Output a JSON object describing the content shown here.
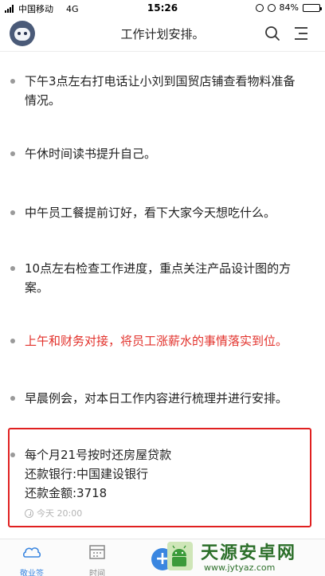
{
  "status_bar": {
    "carrier": "中国移动",
    "network": "4G",
    "time": "15:26",
    "battery": "84%",
    "battery_level": 0.84
  },
  "header": {
    "title": "工作计划安排。",
    "search_icon": "search-icon",
    "menu_icon": "menu-icon",
    "avatar_icon": "robot-avatar-icon"
  },
  "items": [
    {
      "text": "下午3点左右打电话让小刘到国贸店铺查看物料准备情况。",
      "color": "#222222"
    },
    {
      "text": "午休时间读书提升自己。",
      "color": "#222222"
    },
    {
      "text": "中午员工餐提前订好，看下大家今天想吃什么。",
      "color": "#222222"
    },
    {
      "text": "10点左右检查工作进度，重点关注产品设计图的方案。",
      "color": "#222222"
    },
    {
      "text": "上午和财务对接，将员工涨薪水的事情落实到位。",
      "color": "#e2312b"
    },
    {
      "text": "早晨例会，对本日工作内容进行梳理并进行安排。",
      "color": "#222222"
    }
  ],
  "highlight_item": {
    "line1": "每个月21号按时还房屋贷款",
    "line2": "还款银行:中国建设银行",
    "line3": "还款金额:3718",
    "reminder": "今天 20:00"
  },
  "tabbar": {
    "tab1": "敬业签",
    "tab2": "时间",
    "active_color": "#3a86e0",
    "add_label": "+"
  },
  "watermark": {
    "name": "天源安卓网",
    "url": "www.jytyaz.com"
  }
}
